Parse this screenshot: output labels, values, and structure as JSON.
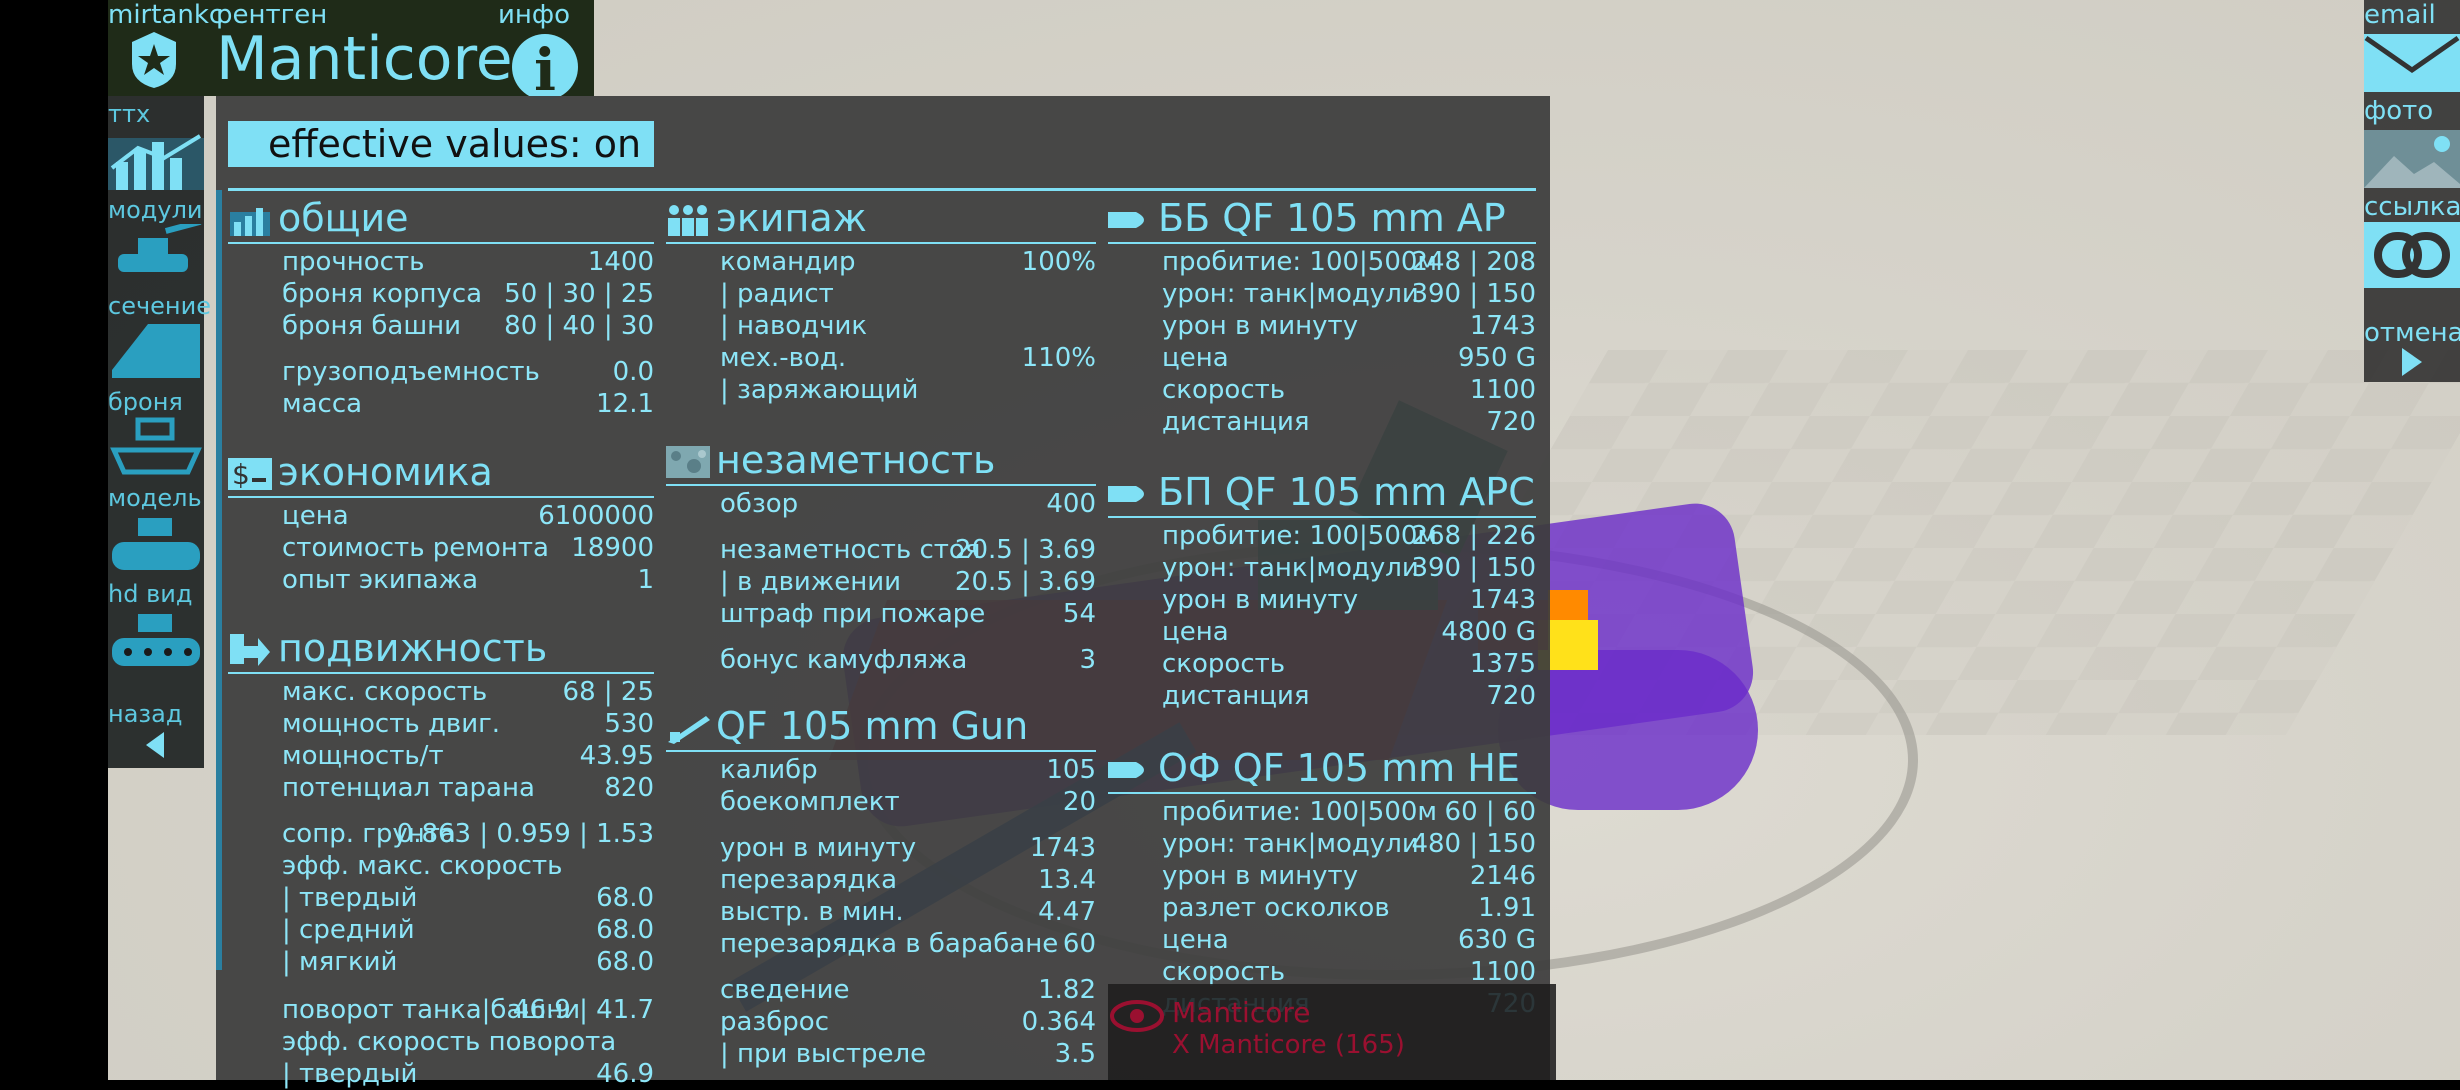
{
  "header": {
    "app_label": "mirtankc",
    "xray_label": "рентген",
    "info_label": "инфо",
    "tank_name": "Manticore"
  },
  "nav": [
    {
      "label": "ттх"
    },
    {
      "label": "модули"
    },
    {
      "label": "сечение"
    },
    {
      "label": "броня"
    },
    {
      "label": "модель"
    },
    {
      "label": "hd вид"
    },
    {
      "label": "назад"
    }
  ],
  "right": {
    "email": "email",
    "photo": "фото",
    "link": "ссылка",
    "cancel": "отмена"
  },
  "toggle": "effective values: on",
  "general": {
    "title": "общие",
    "rows": [
      {
        "k": "прочность",
        "v": "1400"
      },
      {
        "k": "броня корпуса",
        "v": "50 | 30 | 25"
      },
      {
        "k": "броня башни",
        "v": "80 | 40 | 30"
      },
      {
        "k": "грузоподъемность",
        "v": "0.0"
      },
      {
        "k": "масса",
        "v": "12.1"
      }
    ]
  },
  "economy": {
    "title": "экономика",
    "rows": [
      {
        "k": "цена",
        "v": "6100000"
      },
      {
        "k": "стоимость ремонта",
        "v": "18900"
      },
      {
        "k": "опыт экипажа",
        "v": "1"
      }
    ]
  },
  "mobility": {
    "title": "подвижность",
    "rows": [
      {
        "k": "макс. скорость",
        "v": "68 | 25"
      },
      {
        "k": "мощность двиг.",
        "v": "530"
      },
      {
        "k": "мощность/т",
        "v": "43.95"
      },
      {
        "k": "потенциал тарана",
        "v": "820"
      },
      {
        "k": "сопр. грунта",
        "v": "0.863 | 0.959 | 1.53"
      },
      {
        "k": "эфф. макс. скорость",
        "v": ""
      },
      {
        "k": "| твердый",
        "v": "68.0"
      },
      {
        "k": "| средний",
        "v": "68.0"
      },
      {
        "k": "| мягкий",
        "v": "68.0"
      },
      {
        "k": "поворот танка|башни",
        "v": "46.9 | 41.7"
      },
      {
        "k": "эфф. скорость поворота",
        "v": ""
      },
      {
        "k": "| твердый",
        "v": "46.9"
      }
    ]
  },
  "crew": {
    "title": "экипаж",
    "rows": [
      {
        "k": "командир",
        "v": "100%"
      },
      {
        "k": "| радист",
        "v": ""
      },
      {
        "k": "| наводчик",
        "v": ""
      },
      {
        "k": "мех.-вод.",
        "v": "110%"
      },
      {
        "k": "| заряжающий",
        "v": ""
      }
    ]
  },
  "stealth": {
    "title": "незаметность",
    "rows": [
      {
        "k": "обзор",
        "v": "400"
      },
      {
        "k": "незаметность стоя",
        "v": "20.5 | 3.69"
      },
      {
        "k": "| в движении",
        "v": "20.5 | 3.69"
      },
      {
        "k": "штраф при пожаре",
        "v": "54"
      },
      {
        "k": "бонус камуфляжа",
        "v": "3"
      }
    ]
  },
  "gun": {
    "title": "QF 105 mm Gun",
    "rows": [
      {
        "k": "калибр",
        "v": "105"
      },
      {
        "k": "боекомплект",
        "v": "20"
      },
      {
        "k": "урон в минуту",
        "v": "1743"
      },
      {
        "k": "перезарядка",
        "v": "13.4"
      },
      {
        "k": "выстр. в мин.",
        "v": "4.47"
      },
      {
        "k": "перезарядка в барабане",
        "v": "60"
      },
      {
        "k": "сведение",
        "v": "1.82"
      },
      {
        "k": "разброс",
        "v": "0.364"
      },
      {
        "k": "| при выстреле",
        "v": "3.5"
      }
    ]
  },
  "ammo_ap": {
    "title": "ББ QF 105 mm AP",
    "rows": [
      {
        "k": "пробитие: 100|500м",
        "v": "248 | 208"
      },
      {
        "k": "урон: танк|модули",
        "v": "390 | 150"
      },
      {
        "k": "урон в минуту",
        "v": "1743"
      },
      {
        "k": "цена",
        "v": "950 G"
      },
      {
        "k": "скорость",
        "v": "1100"
      },
      {
        "k": "дистанция",
        "v": "720"
      }
    ]
  },
  "ammo_apc": {
    "title": "БП QF 105 mm APC",
    "rows": [
      {
        "k": "пробитие: 100|500м",
        "v": "268 | 226"
      },
      {
        "k": "урон: танк|модули",
        "v": "390 | 150"
      },
      {
        "k": "урон в минуту",
        "v": "1743"
      },
      {
        "k": "цена",
        "v": "4800 G"
      },
      {
        "k": "скорость",
        "v": "1375"
      },
      {
        "k": "дистанция",
        "v": "720"
      }
    ]
  },
  "ammo_he": {
    "title": "ОФ QF 105 mm HE",
    "rows": [
      {
        "k": "пробитие: 100|500м",
        "v": "60 | 60"
      },
      {
        "k": "урон: танк|модули",
        "v": "480 | 150"
      },
      {
        "k": "урон в минуту",
        "v": "2146"
      },
      {
        "k": "разлет осколков",
        "v": "1.91"
      },
      {
        "k": "цена",
        "v": "630 G"
      },
      {
        "k": "скорость",
        "v": "1100"
      },
      {
        "k": "дистанция",
        "v": "720"
      }
    ]
  },
  "tag": {
    "line1": "Manticore",
    "line2": "X Manticore (165)"
  }
}
